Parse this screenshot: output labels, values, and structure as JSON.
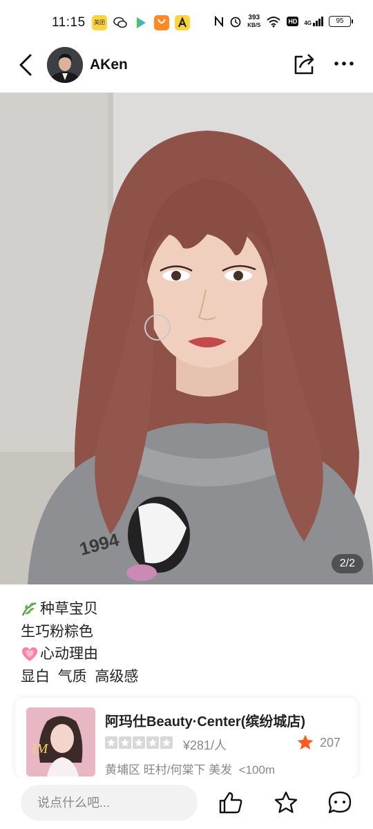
{
  "status_bar": {
    "time": "11:15",
    "app_icon_label": "美团",
    "net_speed_value": "393",
    "net_speed_unit": "KB/S",
    "hd_label": "HD",
    "signal_label": "4G",
    "battery": "95"
  },
  "header": {
    "username": "AKen"
  },
  "photo": {
    "page_indicator": "2/2"
  },
  "post": {
    "lines": [
      "种草宝贝",
      "生巧粉粽色",
      "心动理由",
      "显白  气质  高级感"
    ]
  },
  "shop": {
    "name": "阿玛仕Beauty·Center(缤纷城店)",
    "price": "¥281/人",
    "reviews": "207",
    "meta": "黄埔区 旺村/何棠下 美发  <100m",
    "thumb_text": "IM",
    "rating_color": "#ff5a1f"
  },
  "bottom_bar": {
    "comment_placeholder": "说点什么吧..."
  },
  "colors": {
    "hair": "#9a5a50",
    "wall": "#dcdad8",
    "sweater": "#8f9195"
  }
}
